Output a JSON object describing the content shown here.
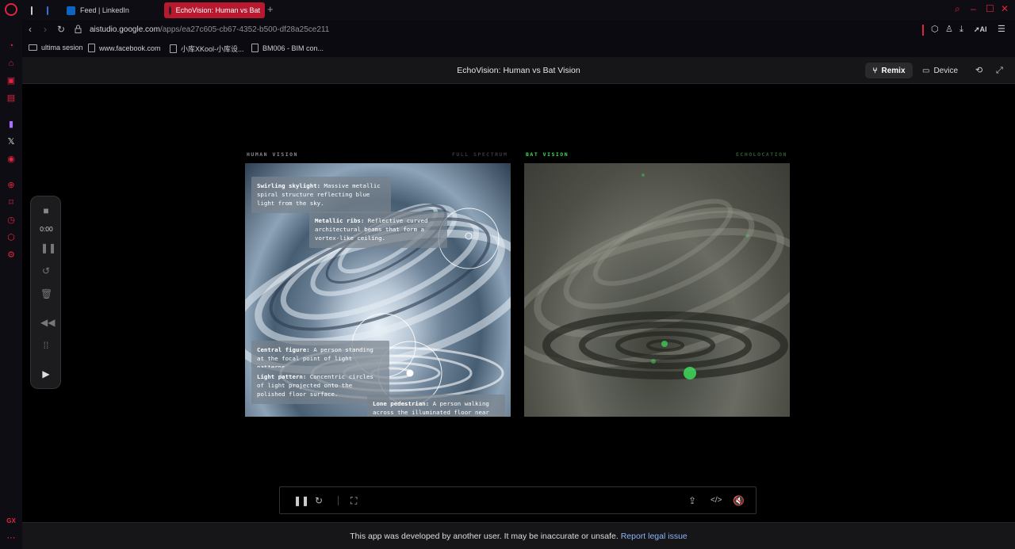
{
  "browser": {
    "tabs": [
      {
        "label": ""
      },
      {
        "label": ""
      },
      {
        "label": "Feed | LinkedIn"
      },
      {
        "label": "EchoVision: Human vs Bat"
      }
    ],
    "new_tab_glyph": "+",
    "url_host": "aistudio.google.com",
    "url_path": "/apps/ea27c605-cb67-4352-b500-df28a25ce211",
    "ai_label": "AI",
    "bookmarks": [
      {
        "label": "ultima sesion",
        "icon": "folder-icon"
      },
      {
        "label": "www.facebook.com",
        "icon": "page-icon"
      },
      {
        "label": "小库XKool-小库设...",
        "icon": "page-icon"
      },
      {
        "label": "BM006 - BIM con...",
        "icon": "page-icon"
      }
    ],
    "accent_color": "#e0243f"
  },
  "app": {
    "title": "EchoVision: Human vs Bat Vision",
    "remix_label": "Remix",
    "device_label": "Device"
  },
  "human_panel": {
    "label": "HUMAN VISION",
    "label_right": "FULL SPECTRUM",
    "notes": [
      {
        "title": "Swirling skylight:",
        "text": "Massive metallic spiral structure reflecting blue light from the sky."
      },
      {
        "title": "Metallic ribs:",
        "text": "Reflective curved architectural beams that form a vortex-like ceiling."
      },
      {
        "title": "Central figure:",
        "text": "A person standing at the focal point of light patterns."
      },
      {
        "title": "Light pattern:",
        "text": "Concentric circles of light projected onto the polished floor surface."
      },
      {
        "title": "Lone pedestrian:",
        "text": "A person walking across the illuminated floor near"
      }
    ]
  },
  "bat_panel": {
    "label": "BAT VISION",
    "label_right": "ECHOLOCATION",
    "accent_color": "#3ddc5a"
  },
  "recorder": {
    "time": "0:00"
  },
  "footer": {
    "text": "This app was developed by another user. It may be inaccurate or unsafe.",
    "link": "Report legal issue"
  }
}
